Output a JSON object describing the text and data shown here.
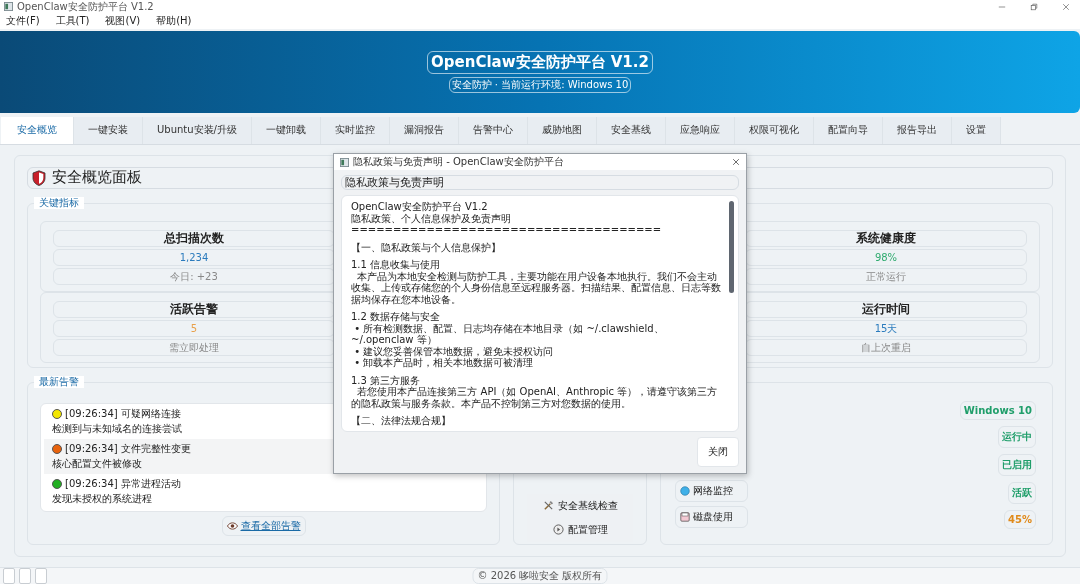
{
  "window": {
    "title": "OpenClaw安全防护平台 V1.2"
  },
  "menu": [
    "文件(F)",
    "工具(T)",
    "视图(V)",
    "帮助(H)"
  ],
  "banner": {
    "title": "OpenClaw安全防护平台 V1.2",
    "subtitle": "安全防护 · 当前运行环境: Windows 10"
  },
  "tabs": [
    {
      "label": "安全概览",
      "selected": true
    },
    {
      "label": "一键安装",
      "selected": false
    },
    {
      "label": "Ubuntu安装/升级",
      "selected": false
    },
    {
      "label": "一键卸载",
      "selected": false
    },
    {
      "label": "实时监控",
      "selected": false
    },
    {
      "label": "漏洞报告",
      "selected": false
    },
    {
      "label": "告警中心",
      "selected": false
    },
    {
      "label": "威胁地图",
      "selected": false
    },
    {
      "label": "安全基线",
      "selected": false
    },
    {
      "label": "应急响应",
      "selected": false
    },
    {
      "label": "权限可视化",
      "selected": false
    },
    {
      "label": "配置向导",
      "selected": false
    },
    {
      "label": "报告导出",
      "selected": false
    },
    {
      "label": "设置",
      "selected": false
    }
  ],
  "panel": {
    "title": "安全概览面板"
  },
  "metrics": {
    "title": "关键指标",
    "items": [
      {
        "title": "总扫描次数",
        "value": "1,234",
        "note": "今日: +23",
        "color": "#2b7bbd"
      },
      {
        "title": "系统健康度",
        "value": "98%",
        "note": "正常运行",
        "color": "#2eaa6e"
      },
      {
        "title": "活跃告警",
        "value": "5",
        "note": "需立即处理",
        "color": "#e8a04a"
      },
      {
        "title": "运行时间",
        "value": "15天",
        "note": "自上次重启",
        "color": "#2b7bbd"
      }
    ]
  },
  "alerts": {
    "title": "最新告警",
    "items": [
      {
        "time": "[09:26:34]",
        "title": "可疑网络连接",
        "detail": "检测到与未知域名的连接尝试",
        "color": "#f2e600"
      },
      {
        "time": "[09:26:34]",
        "title": "文件完整性变更",
        "detail": "核心配置文件被修改",
        "color": "#e8620c"
      },
      {
        "time": "[09:26:34]",
        "title": "异常进程活动",
        "detail": "发现未授权的系统进程",
        "color": "#22b022"
      }
    ],
    "link": "查看全部告警"
  },
  "actions": [
    {
      "label": "安全基线检查",
      "kind": "tools"
    },
    {
      "label": "配置管理",
      "kind": "config"
    }
  ],
  "system": {
    "labels": [
      {
        "label": "网络监控",
        "kind": "network"
      },
      {
        "label": "磁盘使用",
        "kind": "disk"
      }
    ],
    "values": [
      {
        "text": "Windows 10",
        "color": "#1f9e6a"
      },
      {
        "text": "运行中",
        "color": "#1f9e6a"
      },
      {
        "text": "已启用",
        "color": "#1f9e6a"
      },
      {
        "text": "活跃",
        "color": "#1f9e6a"
      },
      {
        "text": "45%",
        "color": "#e08a1a"
      }
    ]
  },
  "status_bar": {
    "text": "© 2026 哆啦安全 版权所有"
  },
  "dialog": {
    "title": "隐私政策与免责声明 - OpenClaw安全防护平台",
    "heading": "隐私政策与免责声明",
    "sections": [
      [
        "OpenClaw安全防护平台 V1.2",
        "隐私政策、个人信息保护及免责声明",
        "====================================="
      ],
      [
        "【一、隐私政策与个人信息保护】"
      ],
      [
        "1.1 信息收集与使用",
        "  本产品为本地安全检测与防护工具，主要功能在用户设备本地执行。我们不会主动收集、上传或存储您的个人身份信息至远程服务器。扫描结果、配置信息、日志等数据均保存在您本地设备。"
      ],
      [
        "1.2 数据存储与安全",
        " • 所有检测数据、配置、日志均存储在本地目录（如 ~/.clawshield、~/.openclaw 等）",
        " • 建议您妥善保管本地数据，避免未授权访问",
        " • 卸载本产品时，相关本地数据可被清理"
      ],
      [
        "1.3 第三方服务",
        "  若您使用本产品连接第三方 API（如 OpenAI、Anthropic 等），请遵守该第三方的隐私政策与服务条款。本产品不控制第三方对您数据的使用。"
      ],
      [
        "【二、法律法规合规】"
      ]
    ],
    "button": "关闭"
  }
}
